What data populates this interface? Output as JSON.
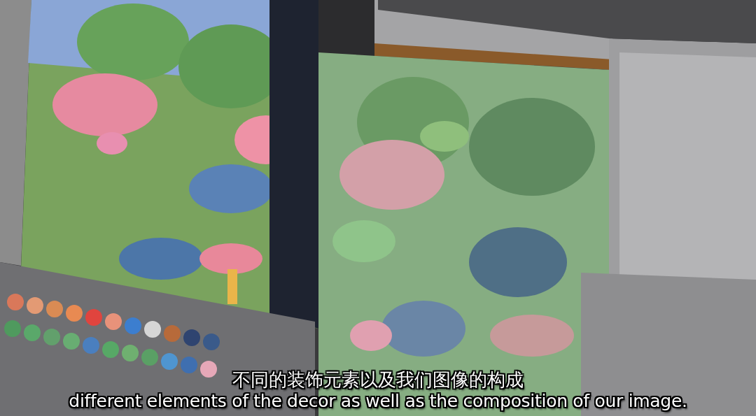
{
  "subtitles": [
    {
      "kind": "chinese",
      "text": "不同的装饰元素以及我们图像的构成"
    },
    {
      "kind": "english",
      "text": "different elements of the decor as well as the composition of our image."
    }
  ]
}
